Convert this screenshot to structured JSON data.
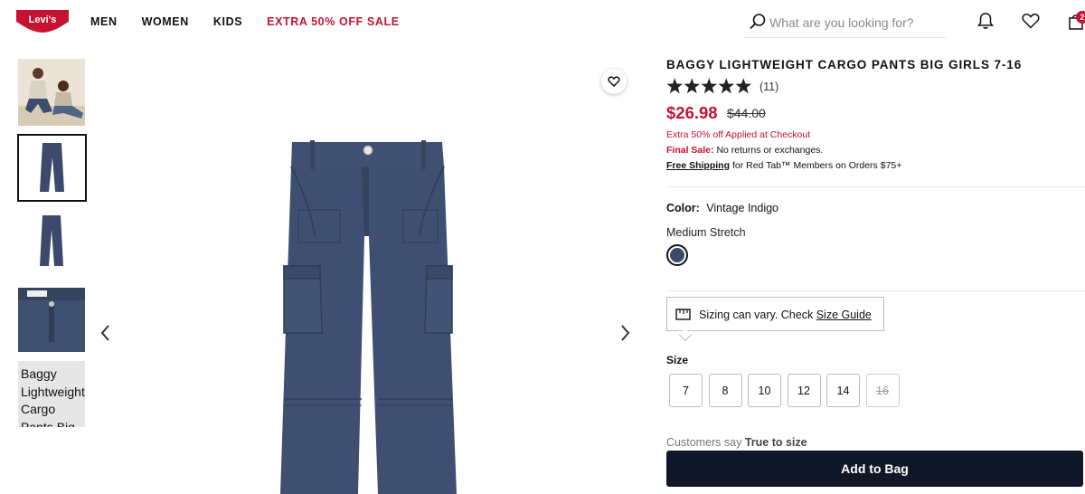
{
  "brand": {
    "logo_text": "Levi's"
  },
  "nav": {
    "items": [
      "MEN",
      "WOMEN",
      "KIDS"
    ],
    "sale": "EXTRA 50% OFF SALE"
  },
  "search": {
    "placeholder": "What are you looking for?"
  },
  "header_icons": [
    "bell-icon",
    "heart-icon",
    "shopping-bag-icon"
  ],
  "bag_count": "2",
  "thumbnails": {
    "alt_text": "Baggy Lightweight Cargo Pants Big"
  },
  "product": {
    "title": "BAGGY LIGHTWEIGHT CARGO PANTS BIG GIRLS 7-16",
    "rating": 5,
    "review_count": "(11)",
    "price": "$26.98",
    "original_price": "$44.00",
    "promo": "Extra 50% off Applied at Checkout",
    "final_sale_label": "Final Sale:",
    "final_sale_text": "No returns or exchanges.",
    "shipping_link": "Free Shipping",
    "shipping_text": "for Red Tab™ Members on Orders $75+",
    "color_label": "Color:",
    "color_value": "Vintage Indigo",
    "fit": "Medium Stretch",
    "swatch_color": "#3b4a6b"
  },
  "size_tip": {
    "text": "Sizing can vary. Check",
    "link": "Size Guide"
  },
  "sizes": {
    "label": "Size",
    "options": [
      {
        "label": "7",
        "available": true
      },
      {
        "label": "8",
        "available": true
      },
      {
        "label": "10",
        "available": true
      },
      {
        "label": "12",
        "available": true
      },
      {
        "label": "14",
        "available": true
      },
      {
        "label": "16",
        "available": false
      }
    ]
  },
  "fit_note": {
    "prefix": "Customers say",
    "value": "True to size"
  },
  "cta": {
    "add_to_bag": "Add to Bag"
  },
  "colors": {
    "accent": "#c41230",
    "cta": "#101828",
    "product": "#3b4a6b"
  }
}
